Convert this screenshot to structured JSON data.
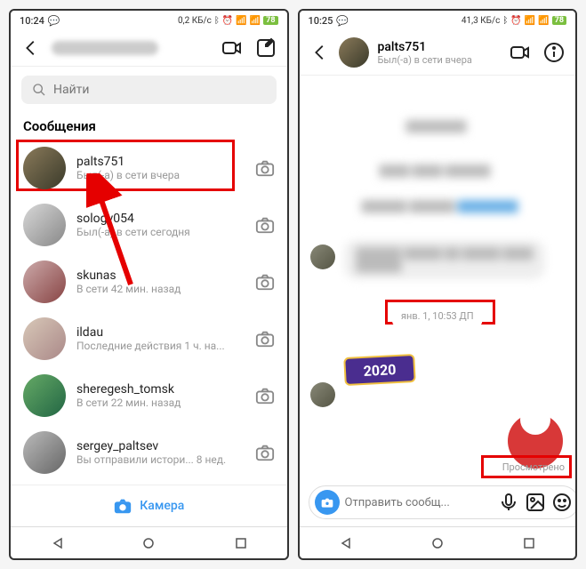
{
  "left": {
    "status": {
      "time": "10:24",
      "net": "0,2 КБ/с",
      "battery": "78"
    },
    "search_placeholder": "Найти",
    "section_title": "Сообщения",
    "chats": [
      {
        "name": "palts751",
        "sub": "Был(-a) в сети вчера"
      },
      {
        "name": "sologv054",
        "sub": "Был(-a) в сети сегодня"
      },
      {
        "name": "skunas",
        "sub": "В сети 42 мин. назад"
      },
      {
        "name": "ildau",
        "sub": "Последние действия 1 ч. на..."
      },
      {
        "name": "sheregesh_tomsk",
        "sub": "В сети 22 мин. назад"
      },
      {
        "name": "sergey_paltsev",
        "sub": "Вы отправили истори...   8 нед."
      }
    ],
    "camera_label": "Камера"
  },
  "right": {
    "status": {
      "time": "10:25",
      "net": "41,3 КБ/с",
      "battery": "78"
    },
    "header": {
      "name": "palts751",
      "sub": "Был(-a) в сети вчера"
    },
    "timestamp": "янв. 1, 10:53 ДП",
    "sticker_text": "2020",
    "seen_label": "Просмотрено",
    "compose_placeholder": "Отправить сообщ..."
  }
}
